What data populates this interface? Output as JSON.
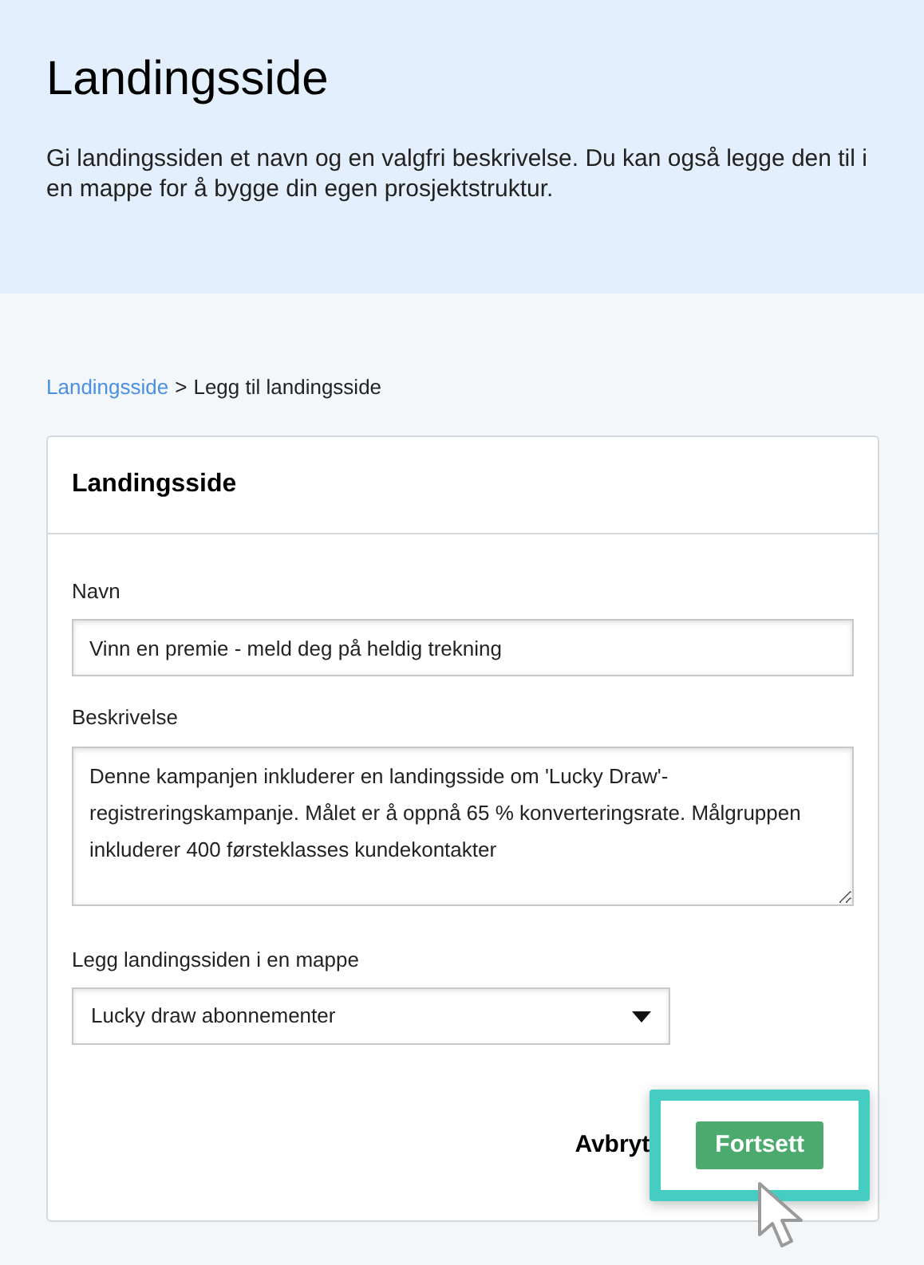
{
  "header": {
    "title": "Landingsside",
    "description": "Gi landingssiden et navn og en valgfri beskrivelse. Du kan også legge den til i en mappe for å bygge din egen prosjektstruktur."
  },
  "breadcrumb": {
    "link": "Landingsside",
    "separator": ">",
    "current": "Legg til landingsside"
  },
  "card": {
    "title": "Landingsside",
    "fields": [
      {
        "kind": "input",
        "label": "Navn",
        "value": "Vinn en premie - meld deg på heldig trekning"
      },
      {
        "kind": "textarea",
        "label": "Beskrivelse",
        "value": "Denne kampanjen inkluderer en landingsside om 'Lucky Draw'-registreringskampanje. Målet er å oppnå 65 % konverteringsrate. Målgruppen inkluderer 400 førsteklasses kundekontakter"
      },
      {
        "kind": "select",
        "label": "Legg landingssiden i en mappe",
        "value": "Lucky draw abonnementer"
      }
    ],
    "buttons": [
      {
        "kind": "plain",
        "label": "Avbryt",
        "highlighted": false
      },
      {
        "kind": "primary",
        "label": "Fortsett",
        "highlighted": true
      }
    ]
  }
}
